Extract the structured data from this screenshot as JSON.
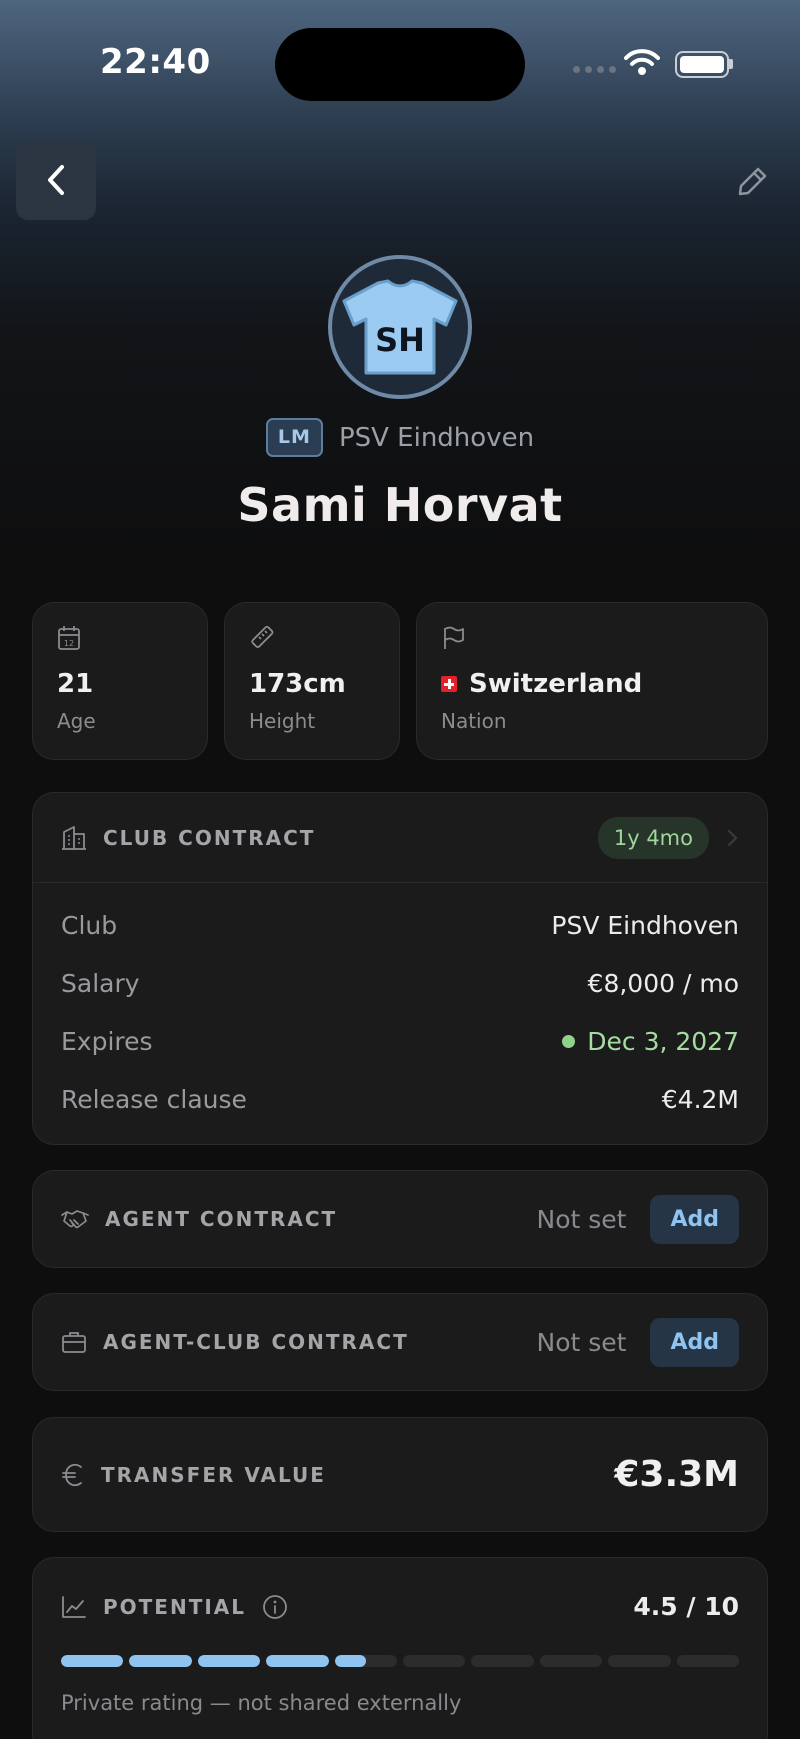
{
  "status_bar": {
    "time": "22:40"
  },
  "player": {
    "initials": "SH",
    "position": "LM",
    "club": "PSV Eindhoven",
    "name": "Sami Horvat"
  },
  "stats": {
    "age": {
      "value": "21",
      "label": "Age",
      "icon": "calendar-icon"
    },
    "height": {
      "value": "173cm",
      "label": "Height",
      "icon": "ruler-icon"
    },
    "nation": {
      "value": "Switzerland",
      "label": "Nation",
      "icon": "flag-icon"
    }
  },
  "club_contract": {
    "title": "CLUB CONTRACT",
    "duration": "1y 4mo",
    "rows": [
      {
        "label": "Club",
        "value": "PSV Eindhoven"
      },
      {
        "label": "Salary",
        "value": "€8,000 / mo"
      },
      {
        "label": "Expires",
        "value": "Dec 3, 2027"
      },
      {
        "label": "Release clause",
        "value": "€4.2M"
      }
    ]
  },
  "agent_contract": {
    "title": "AGENT CONTRACT",
    "status": "Not set",
    "action": "Add"
  },
  "agent_club_contract": {
    "title": "AGENT-CLUB CONTRACT",
    "status": "Not set",
    "action": "Add"
  },
  "transfer_value": {
    "title": "TRANSFER VALUE",
    "value": "€3.3M"
  },
  "potential": {
    "title": "POTENTIAL",
    "score_text": "4.5 / 10",
    "score": 4.5,
    "max": 10,
    "note": "Private rating — not shared externally"
  },
  "colors": {
    "accent": "#90C4F0",
    "positive": "#9FD69A",
    "card_bg": "#1B1B1C",
    "page_bg": "#0E0E0F"
  }
}
